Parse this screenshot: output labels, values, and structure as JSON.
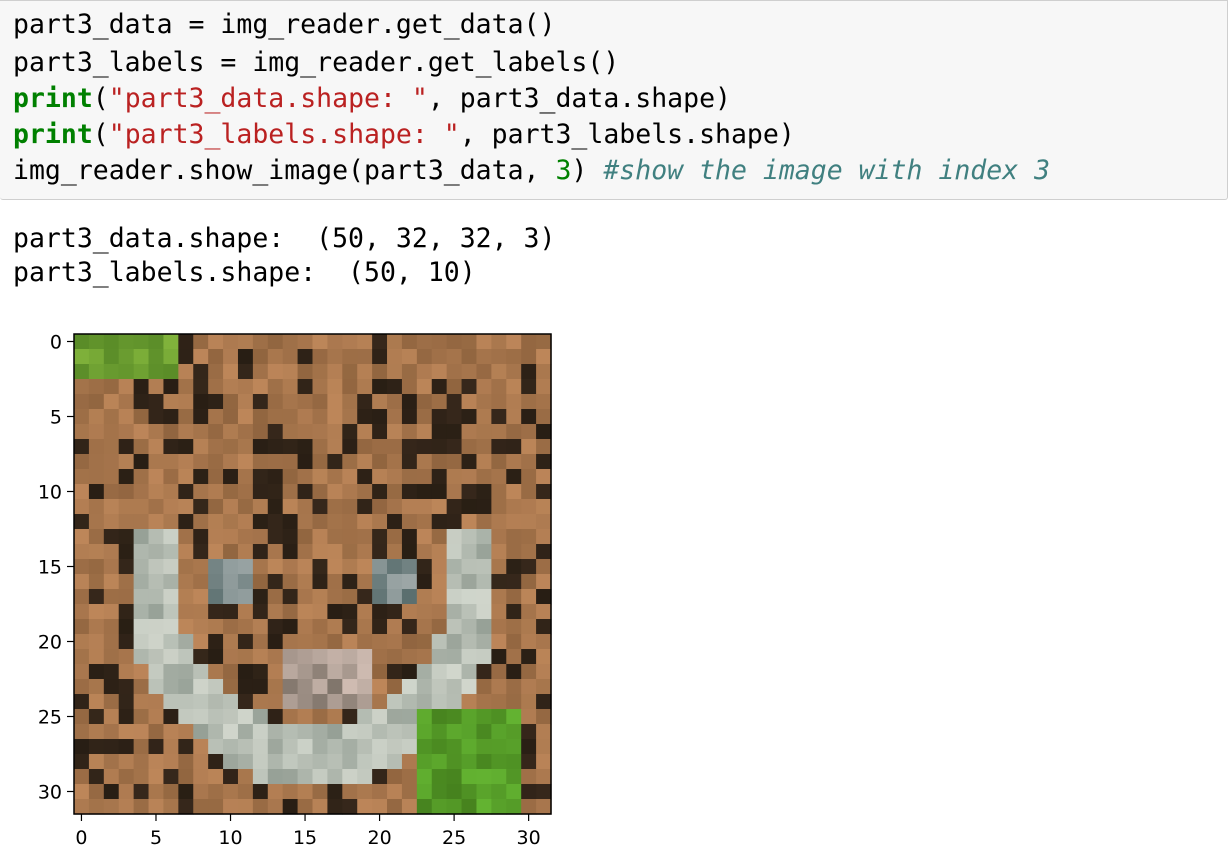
{
  "input_cell": {
    "lines": [
      {
        "tokens": [
          {
            "t": "part3_data = img_reader.get_data()",
            "c": ""
          }
        ]
      },
      {
        "tokens": [
          {
            "t": "part3_labels = img_reader.get_labels()",
            "c": ""
          }
        ]
      },
      {
        "tokens": [
          {
            "t": "print",
            "c": "kw"
          },
          {
            "t": "(",
            "c": ""
          },
          {
            "t": "\"part3_data.shape: \"",
            "c": "str"
          },
          {
            "t": ", part3_data.shape)",
            "c": ""
          }
        ]
      },
      {
        "tokens": [
          {
            "t": "print",
            "c": "kw"
          },
          {
            "t": "(",
            "c": ""
          },
          {
            "t": "\"part3_labels.shape: \"",
            "c": "str"
          },
          {
            "t": ", part3_labels.shape)",
            "c": ""
          }
        ]
      },
      {
        "tokens": [
          {
            "t": "img_reader.show_image(part3_data, ",
            "c": ""
          },
          {
            "t": "3",
            "c": "num"
          },
          {
            "t": ") ",
            "c": ""
          },
          {
            "t": "#show the image with index 3",
            "c": "cmt"
          }
        ]
      }
    ]
  },
  "output_cell": {
    "line1": "part3_data.shape:  (50, 32, 32, 3)",
    "line2": "part3_labels.shape:  (50, 10)"
  },
  "image_plot": {
    "x_ticks": [
      "0",
      "5",
      "10",
      "15",
      "20",
      "25",
      "30"
    ],
    "y_ticks": [
      "0",
      "5",
      "10",
      "15",
      "20",
      "25",
      "30"
    ]
  },
  "colors": {
    "cell_background": "#f7f7f7",
    "cell_border": "#cfcfcf",
    "keyword": "#008000",
    "string": "#ba2121",
    "number": "#008000",
    "comment": "#408080"
  }
}
